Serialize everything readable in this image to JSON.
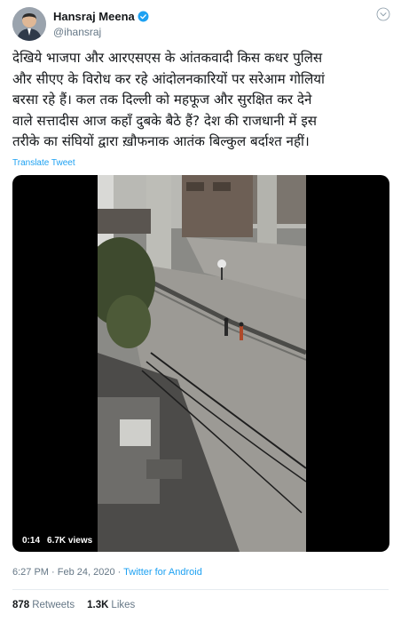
{
  "author": {
    "name": "Hansraj Meena",
    "handle": "@ihansraj",
    "verified": true
  },
  "tweet": {
    "text_lines": [
      "देखिये भाजपा और आरएसएस के आंतकवादी किस कधर पुलिस",
      "और सीएए के विरोध कर रहे आंदोलनकारियों पर सरेआम गोलियां",
      "बरसा रहे हैं। कल तक दिल्ली को महफूज और सुरक्षित कर देने",
      "वाले सत्तादीस आज कहाँ दुबके बैठे हैं? देश की राजधानी में इस",
      "तरीके का संघियों द्वारा ख़ौफनाक आतंक बिल्कुल बर्दाश्त नहीं।"
    ],
    "translate_label": "Translate Tweet"
  },
  "video": {
    "duration": "0:14",
    "views": "6.7K views"
  },
  "meta": {
    "time": "6:27 PM · Feb 24, 2020 · ",
    "source": "Twitter for Android"
  },
  "stats": {
    "retweets_count": "878",
    "retweets_label": "Retweets",
    "likes_count": "1.3K",
    "likes_label": "Likes"
  },
  "colors": {
    "link": "#1da1f2",
    "muted": "#657786",
    "text": "#14171a"
  },
  "icons": {
    "verified": "verified-badge-icon",
    "more": "chevron-down-icon"
  }
}
